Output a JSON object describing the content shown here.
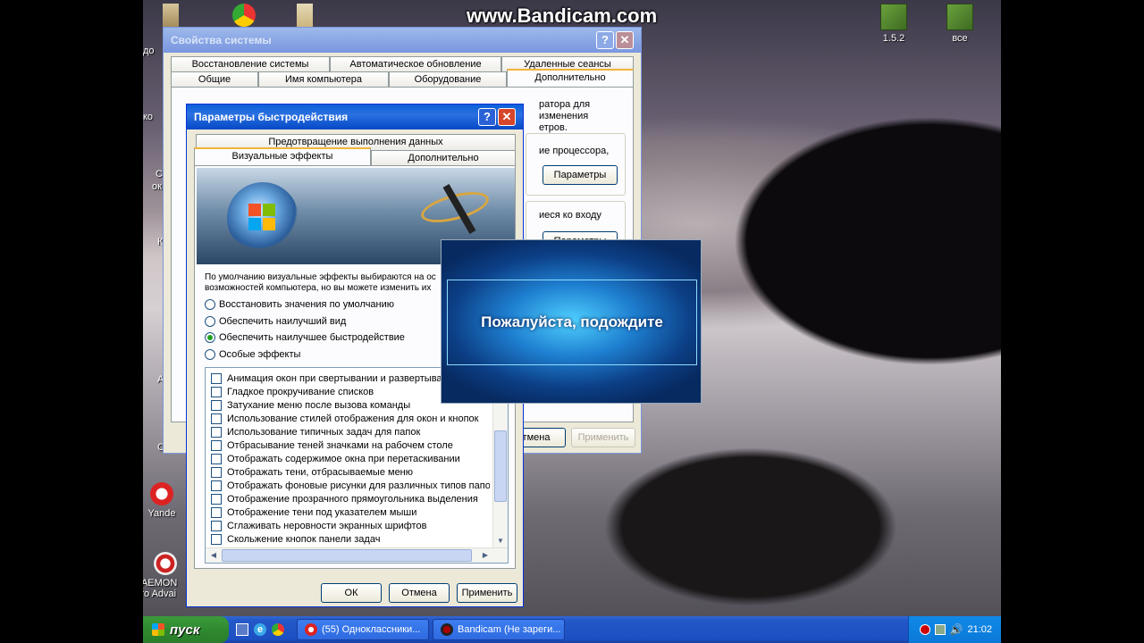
{
  "watermark": "www.Bandicam.com",
  "desktop_icons": [
    {
      "label": "1.5.2"
    },
    {
      "label": "все"
    },
    {
      "label": "Yande"
    },
    {
      "label": "DAEMON"
    },
    {
      "label": "Pro Advai"
    }
  ],
  "edge_fragments": [
    "до",
    "ко",
    "С",
    "ок",
    "К",
    "А",
    "С"
  ],
  "sysprops": {
    "title": "Свойства системы",
    "tabs_top": [
      "Восстановление системы",
      "Автоматическое обновление",
      "Удаленные сеансы"
    ],
    "tabs_bottom": [
      "Общие",
      "Имя компьютера",
      "Оборудование",
      "Дополнительно"
    ],
    "text_fragments": [
      "ратора для изменения",
      "етров.",
      "ие процессора,",
      "иеся ко входу"
    ],
    "params_button": "Параметры",
    "cancel_button": "тмена",
    "apply_button": "Применить"
  },
  "perf": {
    "title": "Параметры быстродействия",
    "tab_top": "Предотвращение выполнения данных",
    "tabs": [
      "Визуальные эффекты",
      "Дополнительно"
    ],
    "description": [
      "По умолчанию визуальные эффекты выбираются на ос",
      "возможностей компьютера, но вы можете изменить их"
    ],
    "options": [
      {
        "label": "Восстановить значения по умолчанию",
        "selected": false
      },
      {
        "label": "Обеспечить наилучший вид",
        "selected": false
      },
      {
        "label": "Обеспечить наилучшее быстродействие",
        "selected": true
      },
      {
        "label": "Особые эффекты",
        "selected": false
      }
    ],
    "effects": [
      "Анимация окон при свертывании и развертывании",
      "Гладкое прокручивание списков",
      "Затухание меню после вызова команды",
      "Использование стилей отображения для окон и кнопок",
      "Использование типичных задач для папок",
      "Отбрасывание теней значками на рабочем столе",
      "Отображать содержимое окна при перетаскивании",
      "Отображать тени, отбрасываемые меню",
      "Отображать фоновые рисунки для различных типов папок",
      "Отображение прозрачного прямоугольника выделения",
      "Отображение тени под указателем мыши",
      "Сглаживать неровности экранных шрифтов",
      "Скольжение кнопок панели задач"
    ],
    "ok": "ОК",
    "cancel": "Отмена",
    "apply": "Применить"
  },
  "wait_dialog": {
    "text": "Пожалуйста, подождите"
  },
  "taskbar": {
    "start_label": "пуск",
    "tasks": [
      "(55) Одноклассники...",
      "Bandicam (Не зареги..."
    ],
    "clock": "21:02"
  },
  "colors": {
    "xp_blue": "#0a5fd8",
    "start_green": "#3c9a3c",
    "dialog_bg": "#ece9d8"
  }
}
